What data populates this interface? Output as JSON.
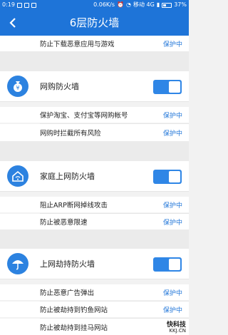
{
  "status_bar": {
    "time": "0:19",
    "speed": "0.06K/s",
    "carrier": "移动 4G",
    "battery": "37%"
  },
  "header": {
    "title": "6层防火墙"
  },
  "top_item": {
    "label": "防止下载恶意应用与游戏",
    "status": "保护中"
  },
  "sections": [
    {
      "icon": "money-bag-icon",
      "title": "网购防火墙",
      "toggle_on": true,
      "items": [
        {
          "label": "保护淘宝、支付宝等网购帐号",
          "status": "保护中"
        },
        {
          "label": "网购时拦截所有风险",
          "status": "保护中"
        }
      ]
    },
    {
      "icon": "home-wifi-icon",
      "title": "家庭上网防火墙",
      "toggle_on": true,
      "items": [
        {
          "label": "阻止ARP断网掉线攻击",
          "status": "保护中"
        },
        {
          "label": "防止被恶意限速",
          "status": "保护中"
        }
      ]
    },
    {
      "icon": "umbrella-icon",
      "title": "上网劫持防火墙",
      "toggle_on": true,
      "items": [
        {
          "label": "防止恶意广告弹出",
          "status": "保护中"
        },
        {
          "label": "防止被劫持到钓鱼网站",
          "status": "保护中"
        },
        {
          "label": "防止被劫持到挂马网站",
          "status": ""
        }
      ]
    }
  ],
  "watermark": {
    "main": "快科技",
    "sub": "KKJ.CN"
  },
  "colors": {
    "primary": "#1e74d8",
    "accent": "#2f86e6"
  }
}
